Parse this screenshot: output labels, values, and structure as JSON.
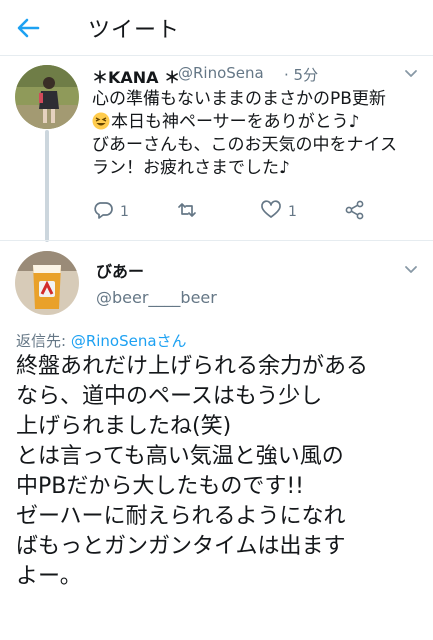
{
  "header": {
    "title": "ツイート"
  },
  "tweet1": {
    "name": "＊KANA ＊",
    "handle": "@RinoSena",
    "time": "· 5分",
    "lines": [
      "心の準備もないままのまさかのPB更新",
      "本日も神ペーサーをありがとう♪",
      "びあーさんも、このお天気の中をナイス",
      "ラン！お疲れさまでした♪"
    ],
    "emoji": "grinning-squinting-face",
    "reply_count": "1",
    "retweet_count": "",
    "like_count": "1"
  },
  "tweet2": {
    "name": "びあー",
    "handle": "@beer____beer",
    "reply_prefix": "返信先: ",
    "reply_mention": "@RinoSenaさん",
    "lines": [
      "終盤あれだけ上げられる余力がある",
      "なら、道中のペースはもう少し",
      "上げられましたね(笑)",
      "とは言っても高い気温と強い風の",
      "中PBだから大したものです!!",
      "ゼーハーに耐えられるようになれ",
      "ばもっとガンガンタイムは出ます",
      "よー。"
    ]
  },
  "colors": {
    "accent": "#1da1f2",
    "muted": "#657786",
    "text": "#14171a",
    "line": "#ccd6dd"
  },
  "icons": [
    "back-arrow-icon",
    "chevron-down-icon",
    "reply-icon",
    "retweet-icon",
    "like-icon",
    "share-icon"
  ]
}
